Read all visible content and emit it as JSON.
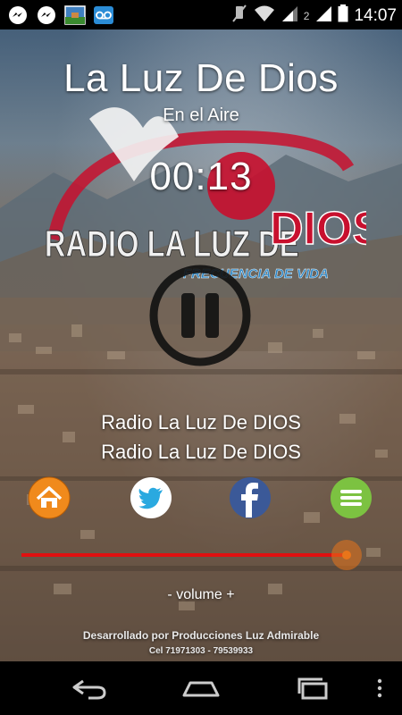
{
  "status_bar": {
    "time": "14:07",
    "sim_label": "2",
    "icons": [
      "messenger-icon",
      "messenger-icon",
      "gallery-thumbnail-icon",
      "voicemail-icon",
      "mute-icon",
      "wifi-icon",
      "signal-icon",
      "signal-icon",
      "battery-icon"
    ]
  },
  "player": {
    "title": "La Luz De Dios",
    "status": "En el Aire",
    "elapsed": "00:13",
    "logo": {
      "line1": "RADIO LA LUZ DE",
      "line2": "DIOS",
      "tagline": "FRECUENCIA DE VIDA"
    },
    "station_line1": "Radio La Luz De DIOS",
    "station_line2": "Radio La Luz De DIOS",
    "volume_label": "- volume +",
    "volume_level": 0.95
  },
  "footer": {
    "credits": "Desarrollado  por Producciones Luz Admirable",
    "phone": "Cel 71971303 - 79539933"
  },
  "colors": {
    "accent_red": "#e01010",
    "home_orange": "#f08a1c",
    "twitter_blue": "#2aa9e0",
    "facebook_blue": "#3b5998",
    "menu_green": "#7cc241"
  }
}
